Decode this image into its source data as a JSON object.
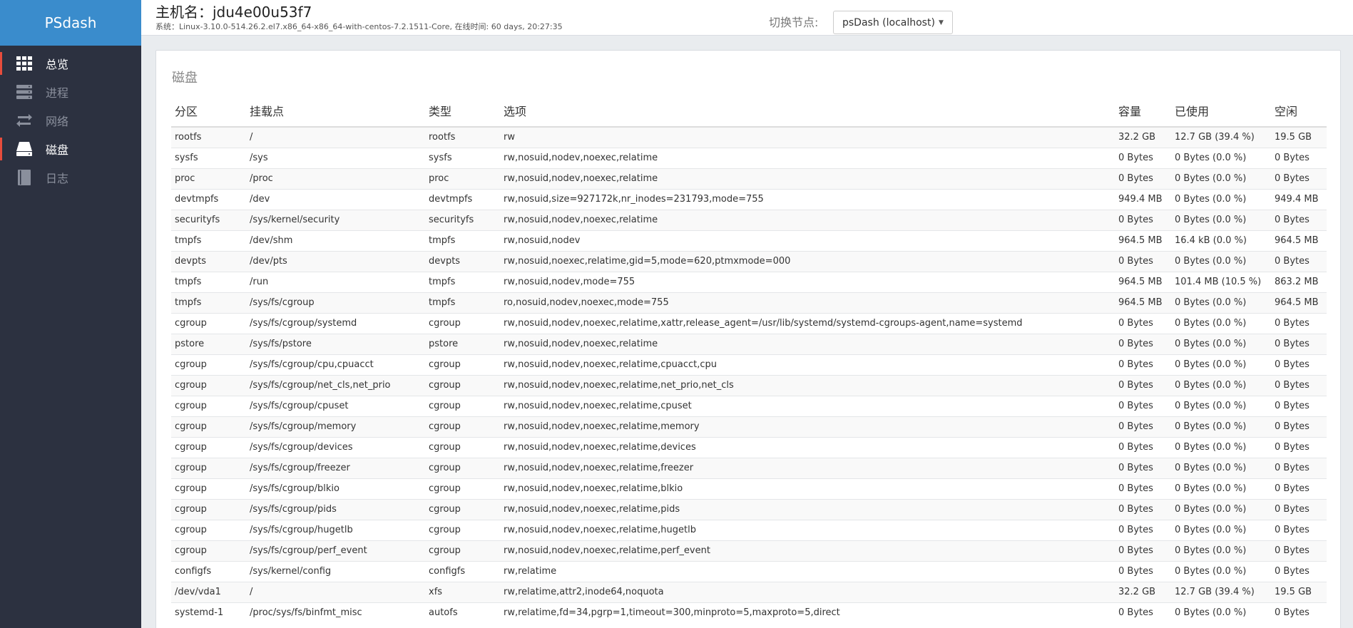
{
  "sidebar": {
    "brand": "PSdash",
    "items": [
      {
        "label": "总览",
        "icon": "grid-icon"
      },
      {
        "label": "进程",
        "icon": "server-icon"
      },
      {
        "label": "网络",
        "icon": "exchange-icon"
      },
      {
        "label": "磁盘",
        "icon": "hdd-icon"
      },
      {
        "label": "日志",
        "icon": "book-icon"
      }
    ],
    "active_index": 3
  },
  "header": {
    "hostname": "主机名：jdu4e00u53f7",
    "sysinfo": "系统：Linux-3.10.0-514.26.2.el7.x86_64-x86_64-with-centos-7.2.1511-Core, 在线时间: 60 days, 20:27:35",
    "node_label": "切换节点:",
    "node_value": "psDash (localhost)"
  },
  "panel": {
    "title": "磁盘",
    "columns": [
      "分区",
      "挂载点",
      "类型",
      "选项",
      "容量",
      "已使用",
      "空闲"
    ],
    "rows": [
      [
        "rootfs",
        "/",
        "rootfs",
        "rw",
        "32.2 GB",
        "12.7 GB (39.4 %)",
        "19.5 GB"
      ],
      [
        "sysfs",
        "/sys",
        "sysfs",
        "rw,nosuid,nodev,noexec,relatime",
        "0 Bytes",
        "0 Bytes (0.0 %)",
        "0 Bytes"
      ],
      [
        "proc",
        "/proc",
        "proc",
        "rw,nosuid,nodev,noexec,relatime",
        "0 Bytes",
        "0 Bytes (0.0 %)",
        "0 Bytes"
      ],
      [
        "devtmpfs",
        "/dev",
        "devtmpfs",
        "rw,nosuid,size=927172k,nr_inodes=231793,mode=755",
        "949.4 MB",
        "0 Bytes (0.0 %)",
        "949.4 MB"
      ],
      [
        "securityfs",
        "/sys/kernel/security",
        "securityfs",
        "rw,nosuid,nodev,noexec,relatime",
        "0 Bytes",
        "0 Bytes (0.0 %)",
        "0 Bytes"
      ],
      [
        "tmpfs",
        "/dev/shm",
        "tmpfs",
        "rw,nosuid,nodev",
        "964.5 MB",
        "16.4 kB (0.0 %)",
        "964.5 MB"
      ],
      [
        "devpts",
        "/dev/pts",
        "devpts",
        "rw,nosuid,noexec,relatime,gid=5,mode=620,ptmxmode=000",
        "0 Bytes",
        "0 Bytes (0.0 %)",
        "0 Bytes"
      ],
      [
        "tmpfs",
        "/run",
        "tmpfs",
        "rw,nosuid,nodev,mode=755",
        "964.5 MB",
        "101.4 MB (10.5 %)",
        "863.2 MB"
      ],
      [
        "tmpfs",
        "/sys/fs/cgroup",
        "tmpfs",
        "ro,nosuid,nodev,noexec,mode=755",
        "964.5 MB",
        "0 Bytes (0.0 %)",
        "964.5 MB"
      ],
      [
        "cgroup",
        "/sys/fs/cgroup/systemd",
        "cgroup",
        "rw,nosuid,nodev,noexec,relatime,xattr,release_agent=/usr/lib/systemd/systemd-cgroups-agent,name=systemd",
        "0 Bytes",
        "0 Bytes (0.0 %)",
        "0 Bytes"
      ],
      [
        "pstore",
        "/sys/fs/pstore",
        "pstore",
        "rw,nosuid,nodev,noexec,relatime",
        "0 Bytes",
        "0 Bytes (0.0 %)",
        "0 Bytes"
      ],
      [
        "cgroup",
        "/sys/fs/cgroup/cpu,cpuacct",
        "cgroup",
        "rw,nosuid,nodev,noexec,relatime,cpuacct,cpu",
        "0 Bytes",
        "0 Bytes (0.0 %)",
        "0 Bytes"
      ],
      [
        "cgroup",
        "/sys/fs/cgroup/net_cls,net_prio",
        "cgroup",
        "rw,nosuid,nodev,noexec,relatime,net_prio,net_cls",
        "0 Bytes",
        "0 Bytes (0.0 %)",
        "0 Bytes"
      ],
      [
        "cgroup",
        "/sys/fs/cgroup/cpuset",
        "cgroup",
        "rw,nosuid,nodev,noexec,relatime,cpuset",
        "0 Bytes",
        "0 Bytes (0.0 %)",
        "0 Bytes"
      ],
      [
        "cgroup",
        "/sys/fs/cgroup/memory",
        "cgroup",
        "rw,nosuid,nodev,noexec,relatime,memory",
        "0 Bytes",
        "0 Bytes (0.0 %)",
        "0 Bytes"
      ],
      [
        "cgroup",
        "/sys/fs/cgroup/devices",
        "cgroup",
        "rw,nosuid,nodev,noexec,relatime,devices",
        "0 Bytes",
        "0 Bytes (0.0 %)",
        "0 Bytes"
      ],
      [
        "cgroup",
        "/sys/fs/cgroup/freezer",
        "cgroup",
        "rw,nosuid,nodev,noexec,relatime,freezer",
        "0 Bytes",
        "0 Bytes (0.0 %)",
        "0 Bytes"
      ],
      [
        "cgroup",
        "/sys/fs/cgroup/blkio",
        "cgroup",
        "rw,nosuid,nodev,noexec,relatime,blkio",
        "0 Bytes",
        "0 Bytes (0.0 %)",
        "0 Bytes"
      ],
      [
        "cgroup",
        "/sys/fs/cgroup/pids",
        "cgroup",
        "rw,nosuid,nodev,noexec,relatime,pids",
        "0 Bytes",
        "0 Bytes (0.0 %)",
        "0 Bytes"
      ],
      [
        "cgroup",
        "/sys/fs/cgroup/hugetlb",
        "cgroup",
        "rw,nosuid,nodev,noexec,relatime,hugetlb",
        "0 Bytes",
        "0 Bytes (0.0 %)",
        "0 Bytes"
      ],
      [
        "cgroup",
        "/sys/fs/cgroup/perf_event",
        "cgroup",
        "rw,nosuid,nodev,noexec,relatime,perf_event",
        "0 Bytes",
        "0 Bytes (0.0 %)",
        "0 Bytes"
      ],
      [
        "configfs",
        "/sys/kernel/config",
        "configfs",
        "rw,relatime",
        "0 Bytes",
        "0 Bytes (0.0 %)",
        "0 Bytes"
      ],
      [
        "/dev/vda1",
        "/",
        "xfs",
        "rw,relatime,attr2,inode64,noquota",
        "32.2 GB",
        "12.7 GB (39.4 %)",
        "19.5 GB"
      ],
      [
        "systemd-1",
        "/proc/sys/fs/binfmt_misc",
        "autofs",
        "rw,relatime,fd=34,pgrp=1,timeout=300,minproto=5,maxproto=5,direct",
        "0 Bytes",
        "0 Bytes (0.0 %)",
        "0 Bytes"
      ]
    ]
  },
  "colors": {
    "sidebar_bg": "#2c3140",
    "brand_bg": "#3a8ccc",
    "active_marker": "#e74c3c"
  }
}
